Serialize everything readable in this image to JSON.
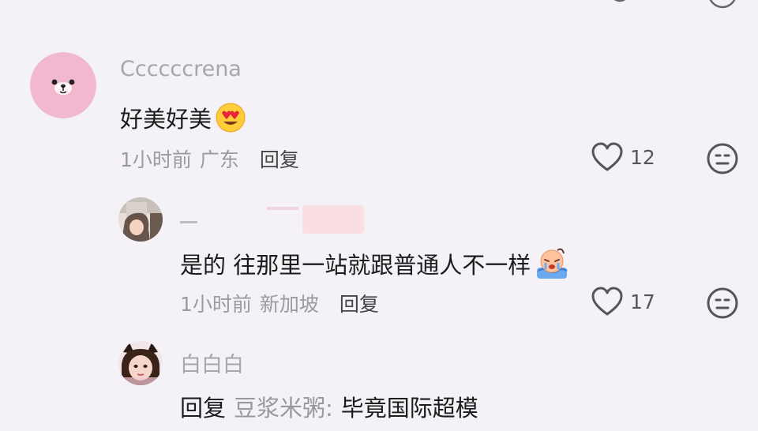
{
  "comments": [
    {
      "username": "Ccccccrena",
      "text": "好美好美",
      "emoji": "heart-eyes-emoji",
      "time": "1小时前",
      "location": "广东",
      "reply_label": "回复",
      "likes": "12"
    },
    {
      "username": "",
      "text": "是的 往那里一站就跟普通人不一样",
      "emoji": "crying-emoji",
      "time": "1小时前",
      "location": "新加坡",
      "reply_label": "回复",
      "likes": "17"
    },
    {
      "username": "白白白",
      "reply_prefix": "回复",
      "reply_to": "豆浆米粥:",
      "text": "毕竟国际超模"
    }
  ],
  "icons": [
    "like-heart-icon",
    "dislike-face-icon"
  ],
  "colors": {
    "background": "#f4f2f6",
    "meta_gray": "#9d9a9e",
    "avatar_pink": "#f2b8cf"
  }
}
